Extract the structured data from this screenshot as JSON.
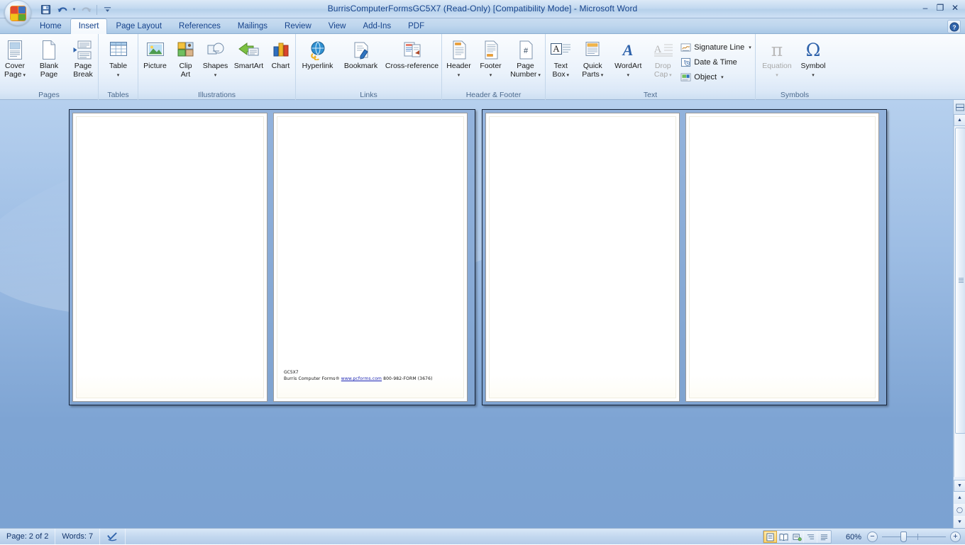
{
  "window": {
    "title": "BurrisComputerFormsGC5X7 (Read-Only) [Compatibility Mode] - Microsoft Word",
    "minimize": "–",
    "maximize": "❐",
    "close": "✕",
    "office_button": "office-button"
  },
  "quick_access": {
    "save": "Save",
    "undo": "Undo",
    "redo": "Redo",
    "customize": "Customize Quick Access Toolbar"
  },
  "help": {
    "label": "?"
  },
  "tabs": [
    {
      "label": "Home",
      "active": false
    },
    {
      "label": "Insert",
      "active": true
    },
    {
      "label": "Page Layout",
      "active": false
    },
    {
      "label": "References",
      "active": false
    },
    {
      "label": "Mailings",
      "active": false
    },
    {
      "label": "Review",
      "active": false
    },
    {
      "label": "View",
      "active": false
    },
    {
      "label": "Add-Ins",
      "active": false
    },
    {
      "label": "PDF",
      "active": false
    }
  ],
  "ribbon": {
    "groups": [
      {
        "name": "Pages",
        "label": "Pages",
        "buttons": [
          {
            "line1": "Cover",
            "line2": "Page",
            "dropdown": true,
            "disabled": false,
            "icon": "cover-page-icon"
          },
          {
            "line1": "Blank",
            "line2": "Page",
            "dropdown": false,
            "disabled": false,
            "icon": "blank-page-icon"
          },
          {
            "line1": "Page",
            "line2": "Break",
            "dropdown": false,
            "disabled": false,
            "icon": "page-break-icon"
          }
        ]
      },
      {
        "name": "Tables",
        "label": "Tables",
        "buttons": [
          {
            "line1": "Table",
            "line2": "",
            "dropdown": true,
            "disabled": false,
            "icon": "table-icon"
          }
        ]
      },
      {
        "name": "Illustrations",
        "label": "Illustrations",
        "buttons": [
          {
            "line1": "Picture",
            "line2": "",
            "dropdown": false,
            "disabled": false,
            "icon": "picture-icon"
          },
          {
            "line1": "Clip",
            "line2": "Art",
            "dropdown": false,
            "disabled": false,
            "icon": "clip-art-icon"
          },
          {
            "line1": "Shapes",
            "line2": "",
            "dropdown": true,
            "disabled": false,
            "icon": "shapes-icon"
          },
          {
            "line1": "SmartArt",
            "line2": "",
            "dropdown": false,
            "disabled": false,
            "icon": "smartart-icon"
          },
          {
            "line1": "Chart",
            "line2": "",
            "dropdown": false,
            "disabled": false,
            "icon": "chart-icon"
          }
        ]
      },
      {
        "name": "Links",
        "label": "Links",
        "buttons": [
          {
            "line1": "Hyperlink",
            "line2": "",
            "dropdown": false,
            "disabled": false,
            "icon": "hyperlink-icon"
          },
          {
            "line1": "Bookmark",
            "line2": "",
            "dropdown": false,
            "disabled": false,
            "icon": "bookmark-icon"
          },
          {
            "line1": "Cross-reference",
            "line2": "",
            "dropdown": false,
            "disabled": false,
            "icon": "cross-reference-icon"
          }
        ]
      },
      {
        "name": "Header & Footer",
        "label": "Header & Footer",
        "buttons": [
          {
            "line1": "Header",
            "line2": "",
            "dropdown": true,
            "disabled": false,
            "icon": "header-icon"
          },
          {
            "line1": "Footer",
            "line2": "",
            "dropdown": true,
            "disabled": false,
            "icon": "footer-icon"
          },
          {
            "line1": "Page",
            "line2": "Number",
            "dropdown": true,
            "disabled": false,
            "icon": "page-number-icon"
          }
        ]
      },
      {
        "name": "Text",
        "label": "Text",
        "buttons": [
          {
            "line1": "Text",
            "line2": "Box",
            "dropdown": true,
            "disabled": false,
            "icon": "text-box-icon"
          },
          {
            "line1": "Quick",
            "line2": "Parts",
            "dropdown": true,
            "disabled": false,
            "icon": "quick-parts-icon"
          },
          {
            "line1": "WordArt",
            "line2": "",
            "dropdown": true,
            "disabled": false,
            "icon": "wordart-icon"
          },
          {
            "line1": "Drop",
            "line2": "Cap",
            "dropdown": true,
            "disabled": true,
            "icon": "drop-cap-icon"
          }
        ],
        "small_buttons": [
          {
            "label": "Signature Line",
            "dropdown": true,
            "icon": "signature-line-icon"
          },
          {
            "label": "Date & Time",
            "dropdown": false,
            "icon": "date-time-icon"
          },
          {
            "label": "Object",
            "dropdown": true,
            "icon": "object-icon"
          }
        ]
      },
      {
        "name": "Symbols",
        "label": "Symbols",
        "buttons": [
          {
            "line1": "Equation",
            "line2": "",
            "dropdown": true,
            "disabled": true,
            "icon": "equation-icon",
            "glyph": "π"
          },
          {
            "line1": "Symbol",
            "line2": "",
            "dropdown": true,
            "disabled": false,
            "icon": "symbol-icon",
            "glyph": "Ω"
          }
        ]
      }
    ]
  },
  "document": {
    "page_code": "GC5X7",
    "footer_prefix": "Burris Computer Forms® ",
    "footer_link": "www.pcforms.com",
    "footer_suffix": " 800-982-FORM (3676)"
  },
  "statusbar": {
    "page": "Page: 2 of 2",
    "words": "Words: 7",
    "proofing": "proofing-errors-icon",
    "zoom": "60%",
    "views": [
      {
        "name": "print-layout",
        "active": true
      },
      {
        "name": "full-screen-reading",
        "active": false
      },
      {
        "name": "web-layout",
        "active": false
      },
      {
        "name": "outline",
        "active": false
      },
      {
        "name": "draft",
        "active": false
      }
    ]
  },
  "scrollbar": {
    "select_browse_object": "select-browse-object",
    "previous_page": "previous-page",
    "next_page": "next-page"
  }
}
